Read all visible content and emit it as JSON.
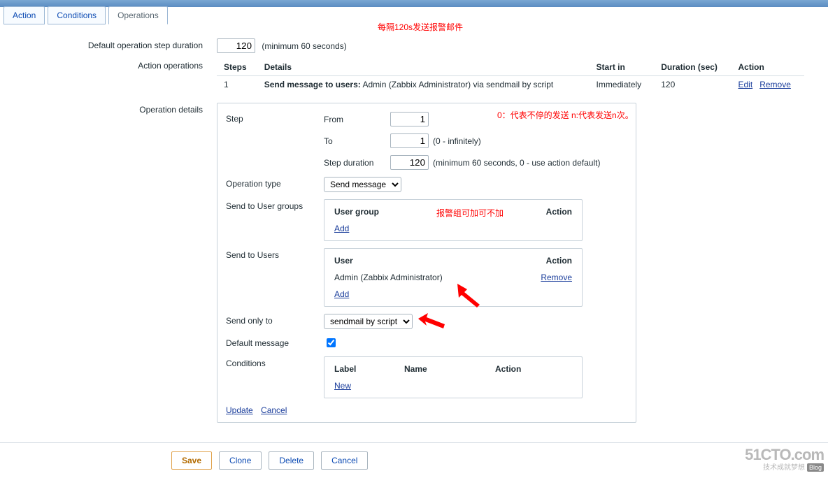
{
  "tabs": {
    "action": "Action",
    "conditions": "Conditions",
    "operations": "Operations"
  },
  "labels": {
    "default_step_duration": "Default operation step duration",
    "min60": "(minimum 60 seconds)",
    "action_operations": "Action operations",
    "operation_details": "Operation details",
    "step": "Step",
    "from": "From",
    "to": "To",
    "step_duration": "Step duration",
    "infinitely": "(0 - infinitely)",
    "min_use_default": "(minimum 60 seconds, 0 - use action default)",
    "operation_type": "Operation type",
    "send_to_user_groups": "Send to User groups",
    "send_to_users": "Send to Users",
    "send_only_to": "Send only to",
    "default_message": "Default message",
    "conditions": "Conditions"
  },
  "values": {
    "default_step_duration": "120",
    "step_from": "1",
    "step_to": "1",
    "step_duration": "120",
    "operation_type": "Send message",
    "send_only_to": "sendmail by script",
    "default_message_checked": true
  },
  "action_table": {
    "headers": {
      "steps": "Steps",
      "details": "Details",
      "start_in": "Start in",
      "duration": "Duration (sec)",
      "action": "Action"
    },
    "row": {
      "steps": "1",
      "details_prefix": "Send message to users:",
      "details_rest": " Admin (Zabbix Administrator) via sendmail by script",
      "start_in": "Immediately",
      "duration": "120",
      "edit": "Edit",
      "remove": "Remove"
    }
  },
  "user_group_box": {
    "col1": "User group",
    "col2": "Action",
    "add": "Add"
  },
  "users_box": {
    "col1": "User",
    "col2": "Action",
    "user_name": "Admin (Zabbix Administrator)",
    "remove": "Remove",
    "add": "Add"
  },
  "cond_box": {
    "label": "Label",
    "name": "Name",
    "action": "Action",
    "new": "New"
  },
  "op_footer": {
    "update": "Update",
    "cancel": "Cancel"
  },
  "buttons": {
    "save": "Save",
    "clone": "Clone",
    "delete": "Delete",
    "cancel": "Cancel"
  },
  "annotations": {
    "a1": "每隔120s发送报警邮件",
    "a2": "0：代表不停的发送 n:代表发送n次。",
    "a3": "报警组可加可不加"
  },
  "watermark": {
    "big": "51CTO.com",
    "small": "技术成就梦想",
    "blog": "Blog"
  }
}
